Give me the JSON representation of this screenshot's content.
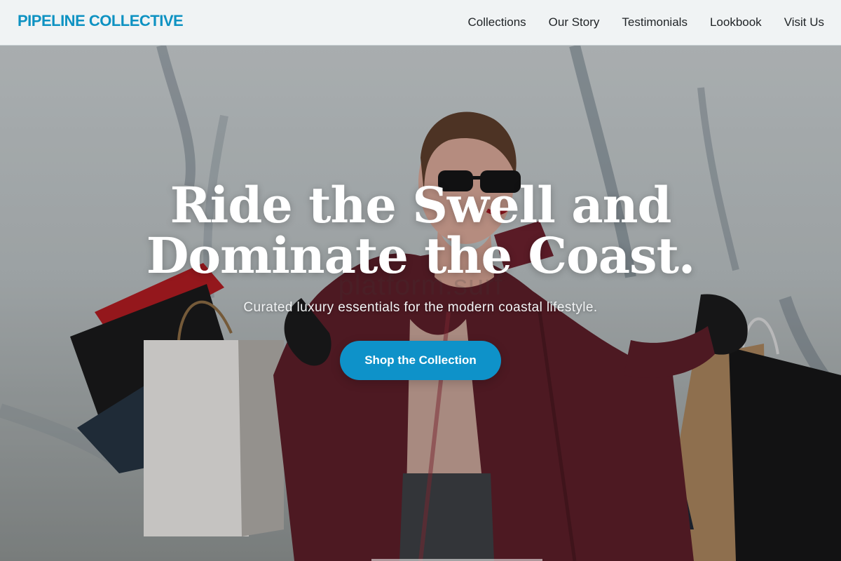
{
  "brand": {
    "name": "PIPELINE COLLECTIVE",
    "color": "#0e92c2"
  },
  "nav": {
    "items": [
      {
        "label": "Collections"
      },
      {
        "label": "Our Story"
      },
      {
        "label": "Testimonials"
      },
      {
        "label": "Lookbook"
      },
      {
        "label": "Visit Us"
      }
    ]
  },
  "hero": {
    "title": "Ride the Swell and Dominate the Coast.",
    "subtitle": "Curated luxury essentials for the modern coastal lifestyle.",
    "watermark": "platform.surf",
    "cta_label": "Shop the Collection",
    "cta_color": "#0e92c9",
    "image_subject": "woman-with-shopping-bags"
  }
}
